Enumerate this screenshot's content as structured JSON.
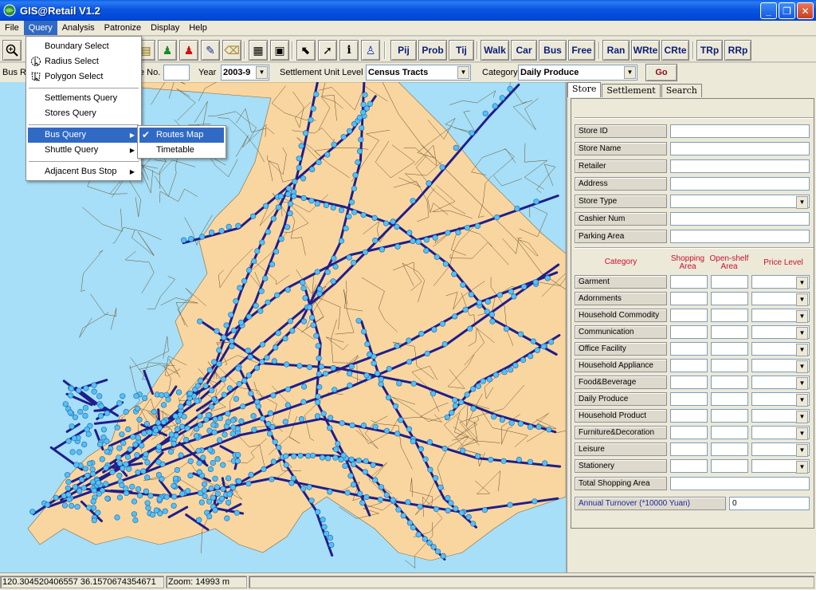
{
  "window": {
    "title": "GIS@Retail V1.2"
  },
  "menubar": [
    "File",
    "Query",
    "Analysis",
    "Patronize",
    "Display",
    "Help"
  ],
  "toolbar": {
    "text_buttons": [
      "Pij",
      "Prob",
      "Tij",
      "Walk",
      "Car",
      "Bus",
      "Free",
      "Ran",
      "WRte",
      "CRte",
      "TRp",
      "RRp"
    ]
  },
  "filterbar": {
    "bus_label": "Bus R",
    "route_no_label": "e No.",
    "year_label": "Year",
    "year_value": "2003-9",
    "settlement_label": "Settlement Unit Level",
    "settlement_value": "Census Tracts",
    "category_label": "Category",
    "category_value": "Daily Produce",
    "go_label": "Go"
  },
  "query_menu": {
    "items": [
      "Boundary Select",
      "Radius Select",
      "Polygon Select",
      "Settlements Query",
      "Stores Query",
      "Bus Query",
      "Shuttle Query",
      "Adjacent Bus Stop"
    ]
  },
  "bus_submenu": {
    "items": [
      "Routes Map",
      "Timetable"
    ],
    "checked": "Routes Map"
  },
  "panel": {
    "tabs": [
      "Store",
      "Settlement",
      "Search"
    ],
    "store_fields": [
      "Store ID",
      "Store Name",
      "Retailer",
      "Address",
      "Store Type",
      "Cashier Num",
      "Parking Area"
    ],
    "cat_headers": {
      "category": "Category",
      "shopping": "Shopping Area",
      "openshelf": "Open-shelf Area",
      "price": "Price Level"
    },
    "categories": [
      "Garment",
      "Adornments",
      "Household Commodity",
      "Communication",
      "Office Facility",
      "Household Appliance",
      "Food&Beverage",
      "Daily Produce",
      "Household Product",
      "Furniture&Decoration",
      "Leisure",
      "Stationery"
    ],
    "total_label": "Total Shopping Area",
    "turnover_label": "Annual Turnover (*10000 Yuan)",
    "turnover_value": "0"
  },
  "statusbar": {
    "coords": "120.304520406557  36.1570674354671",
    "zoom": "Zoom:  14993 m"
  },
  "colors": {
    "sea": "#a6dff7",
    "land": "#f9d6a0",
    "route": "#1e1e8c",
    "stop": "#4fc3f2",
    "menu_highlight": "#316ac5"
  }
}
